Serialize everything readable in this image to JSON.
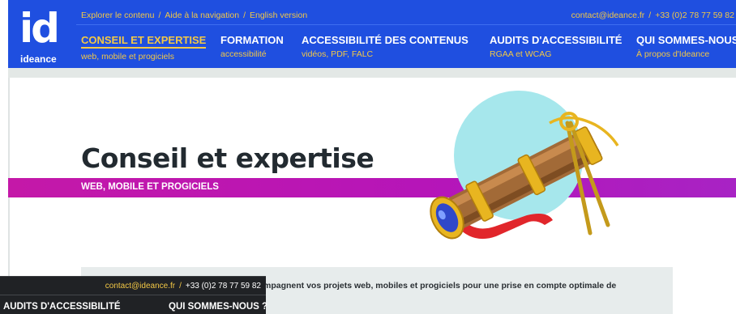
{
  "logo": {
    "mark": "id",
    "name": "ideance"
  },
  "toplinks": [
    {
      "label": "Explorer le contenu"
    },
    {
      "label": "Aide à la navigation"
    },
    {
      "label": "English version"
    }
  ],
  "contact": {
    "email": "contact@ideance.fr",
    "phone": "+33 (0)2 78 77 59 82"
  },
  "nav": [
    {
      "label": "CONSEIL ET EXPERTISE",
      "sub": "web, mobile et progiciels",
      "active": true
    },
    {
      "label": "FORMATION",
      "sub": "accessibilité"
    },
    {
      "label": "ACCESSIBILITÉ DES CONTENUS",
      "sub": "vidéos, PDF, FALC"
    },
    {
      "label": "AUDITS D'ACCESSIBILITÉ",
      "sub": "RGAA et WCAG"
    },
    {
      "label": "QUI SOMMES-NOUS ?",
      "sub": "À propos d'Ideance"
    }
  ],
  "page": {
    "title": "Conseil et expertise",
    "subtitle": "WEB, MOBILE ET PROGICIELS",
    "intro": "mpagnent vos projets web, mobiles et progiciels pour une prise en compte optimale de"
  },
  "sticky": {
    "email": "contact@ideance.fr",
    "phone": "+33 (0)2 78 77 59 82",
    "nav": [
      "AUDITS D'ACCESSIBILITÉ",
      "QUI SOMMES-NOUS ?"
    ]
  },
  "colors": {
    "header_bg": "#1f4fe0",
    "accent_yellow": "#f3c845",
    "magenta_band": "#c418a8",
    "sticky_bg": "#202225"
  },
  "illustration": {
    "icon": "telescope-scroll-with-compass-icon"
  }
}
